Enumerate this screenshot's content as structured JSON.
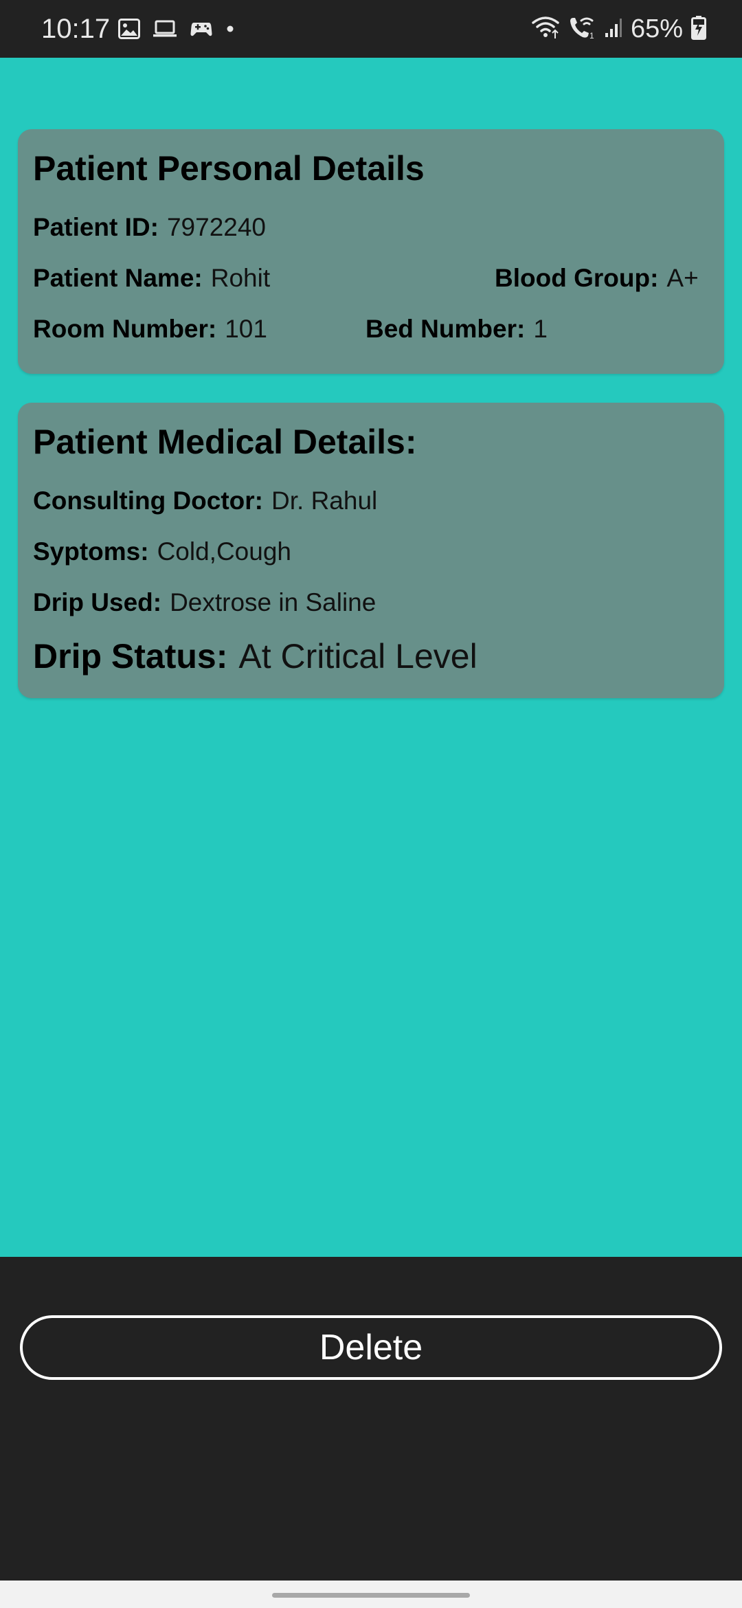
{
  "status_bar": {
    "time": "10:17",
    "battery": "65%",
    "left_icons": [
      "gallery-icon",
      "laptop-icon",
      "game-controller-icon",
      "dot-icon"
    ],
    "right_icons": [
      "wifi-icon",
      "wifi-calling-icon",
      "signal-icon",
      "battery-charging-icon"
    ]
  },
  "colors": {
    "background": "#25c9be",
    "card": "#67908a",
    "bars": "#222222",
    "button_border": "#ffffff"
  },
  "personal": {
    "title": "Patient Personal Details",
    "id_label": "Patient ID:",
    "id_value": "7972240",
    "name_label": "Patient Name:",
    "name_value": "Rohit",
    "blood_label": "Blood Group:",
    "blood_value": "A+",
    "room_label": "Room Number:",
    "room_value": "101",
    "bed_label": "Bed Number:",
    "bed_value": "1"
  },
  "medical": {
    "title": "Patient Medical Details:",
    "doctor_label": "Consulting Doctor:",
    "doctor_value": "Dr. Rahul",
    "symptoms_label": "Syptoms:",
    "symptoms_value": "Cold,Cough",
    "drip_label": "Drip Used:",
    "drip_value": "Dextrose in Saline",
    "status_label": "Drip Status:",
    "status_value": "At Critical Level"
  },
  "actions": {
    "delete_label": "Delete"
  }
}
